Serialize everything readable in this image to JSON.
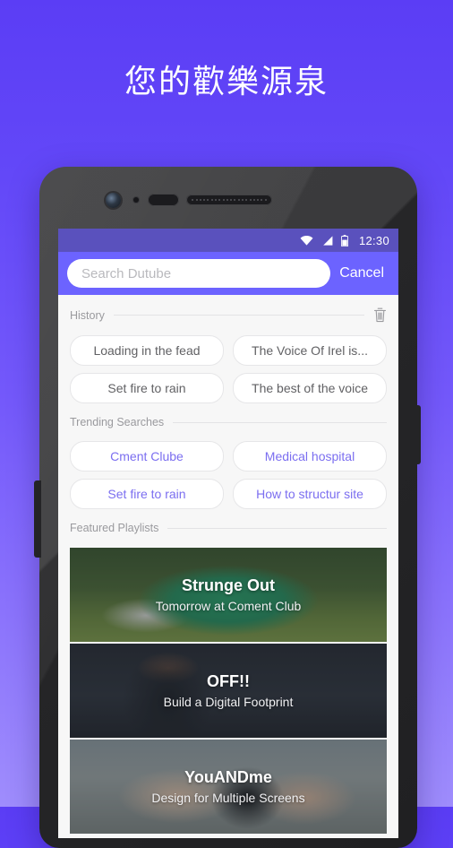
{
  "hero": {
    "title": "您的歡樂源泉"
  },
  "phone": {
    "hardware": {
      "front_camera": "front-camera",
      "proximity_sensor": "proximity-sensor",
      "earpiece": "earpiece-speaker",
      "speaker_grille": "speaker-grille",
      "volume_button": "volume-button",
      "power_button": "power-button"
    }
  },
  "status_bar": {
    "wifi": "wifi-icon",
    "signal": "signal-icon",
    "battery": "battery-icon",
    "time": "12:30"
  },
  "search": {
    "placeholder": "Search Dutube",
    "value": "",
    "cancel_label": "Cancel"
  },
  "history": {
    "title": "History",
    "clear_icon": "trash-icon",
    "chips": [
      "Loading in the fead",
      "The Voice Of Irel is...",
      "Set fire to rain",
      "The best of the voice"
    ]
  },
  "trending": {
    "title": "Trending Searches",
    "chips": [
      "Cment Clube",
      "Medical hospital",
      "Set fire to rain",
      "How to structur site"
    ]
  },
  "featured": {
    "title": "Featured Playlists",
    "cards": [
      {
        "title": "Strunge Out",
        "subtitle": "Tomorrow at Coment Club",
        "art": "green-van-in-forest"
      },
      {
        "title": "OFF!!",
        "subtitle": "Build a Digital Footprint",
        "art": "man-by-dark-wall"
      },
      {
        "title": "YouANDme",
        "subtitle": "Design for Multiple Screens",
        "art": "person-holding-camera"
      }
    ]
  },
  "colors": {
    "background_top": "#5b3df5",
    "background_bottom": "#9f8dfd",
    "status_bar": "#5a51bd",
    "search_bar": "#6c63ff",
    "accent_chip_text": "#7b6ef0",
    "screen_background": "#f7f7f7"
  }
}
